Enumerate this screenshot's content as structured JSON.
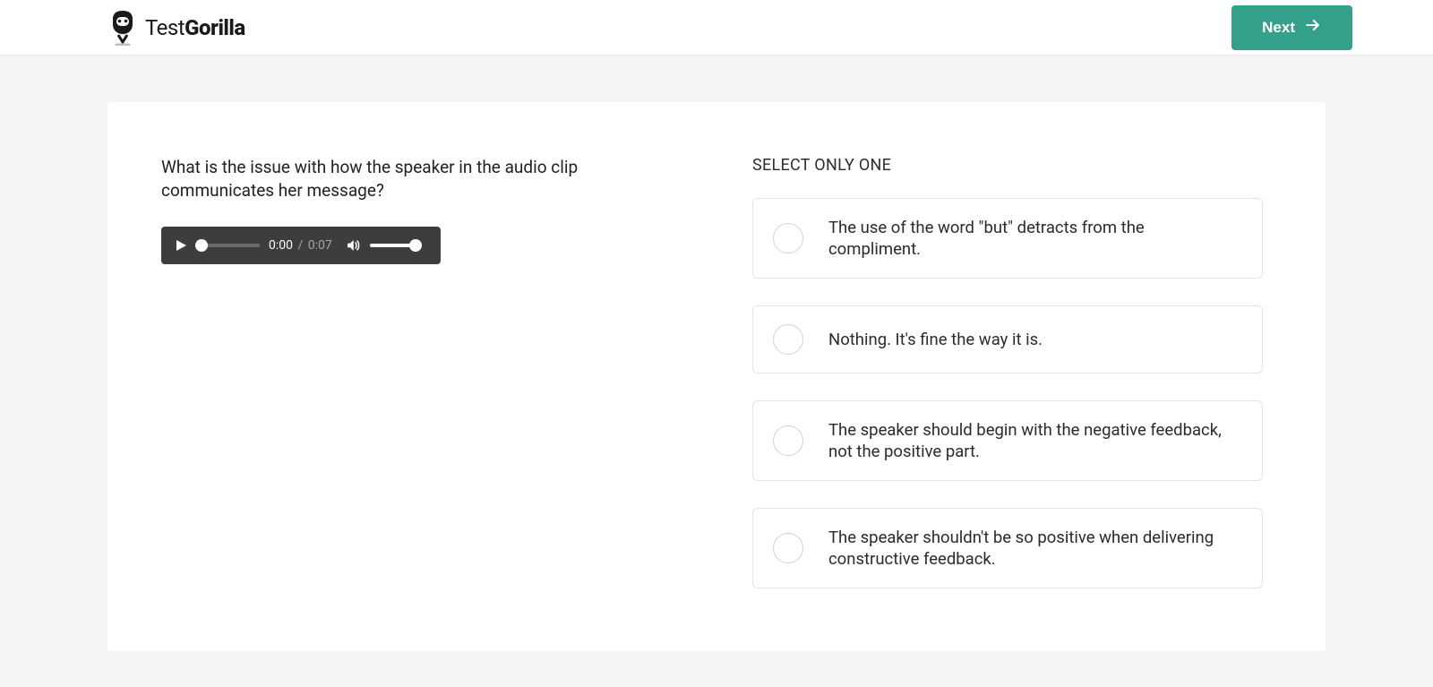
{
  "header": {
    "logo_part1": "Test",
    "logo_part2": "Gorilla",
    "next_label": "Next"
  },
  "question": {
    "text": "What is the issue with how the speaker in the audio clip communicates her message?"
  },
  "audio": {
    "current_time": "0:00",
    "separator": "/",
    "duration": "0:07"
  },
  "answers": {
    "instruction": "SELECT ONLY ONE",
    "options": [
      {
        "label": "The use of the word \"but\" detracts from the compliment."
      },
      {
        "label": "Nothing. It's fine the way it is."
      },
      {
        "label": "The speaker should begin with the negative feedback, not the positive part."
      },
      {
        "label": "The speaker shouldn't be so positive when delivering constructive feedback."
      }
    ]
  }
}
